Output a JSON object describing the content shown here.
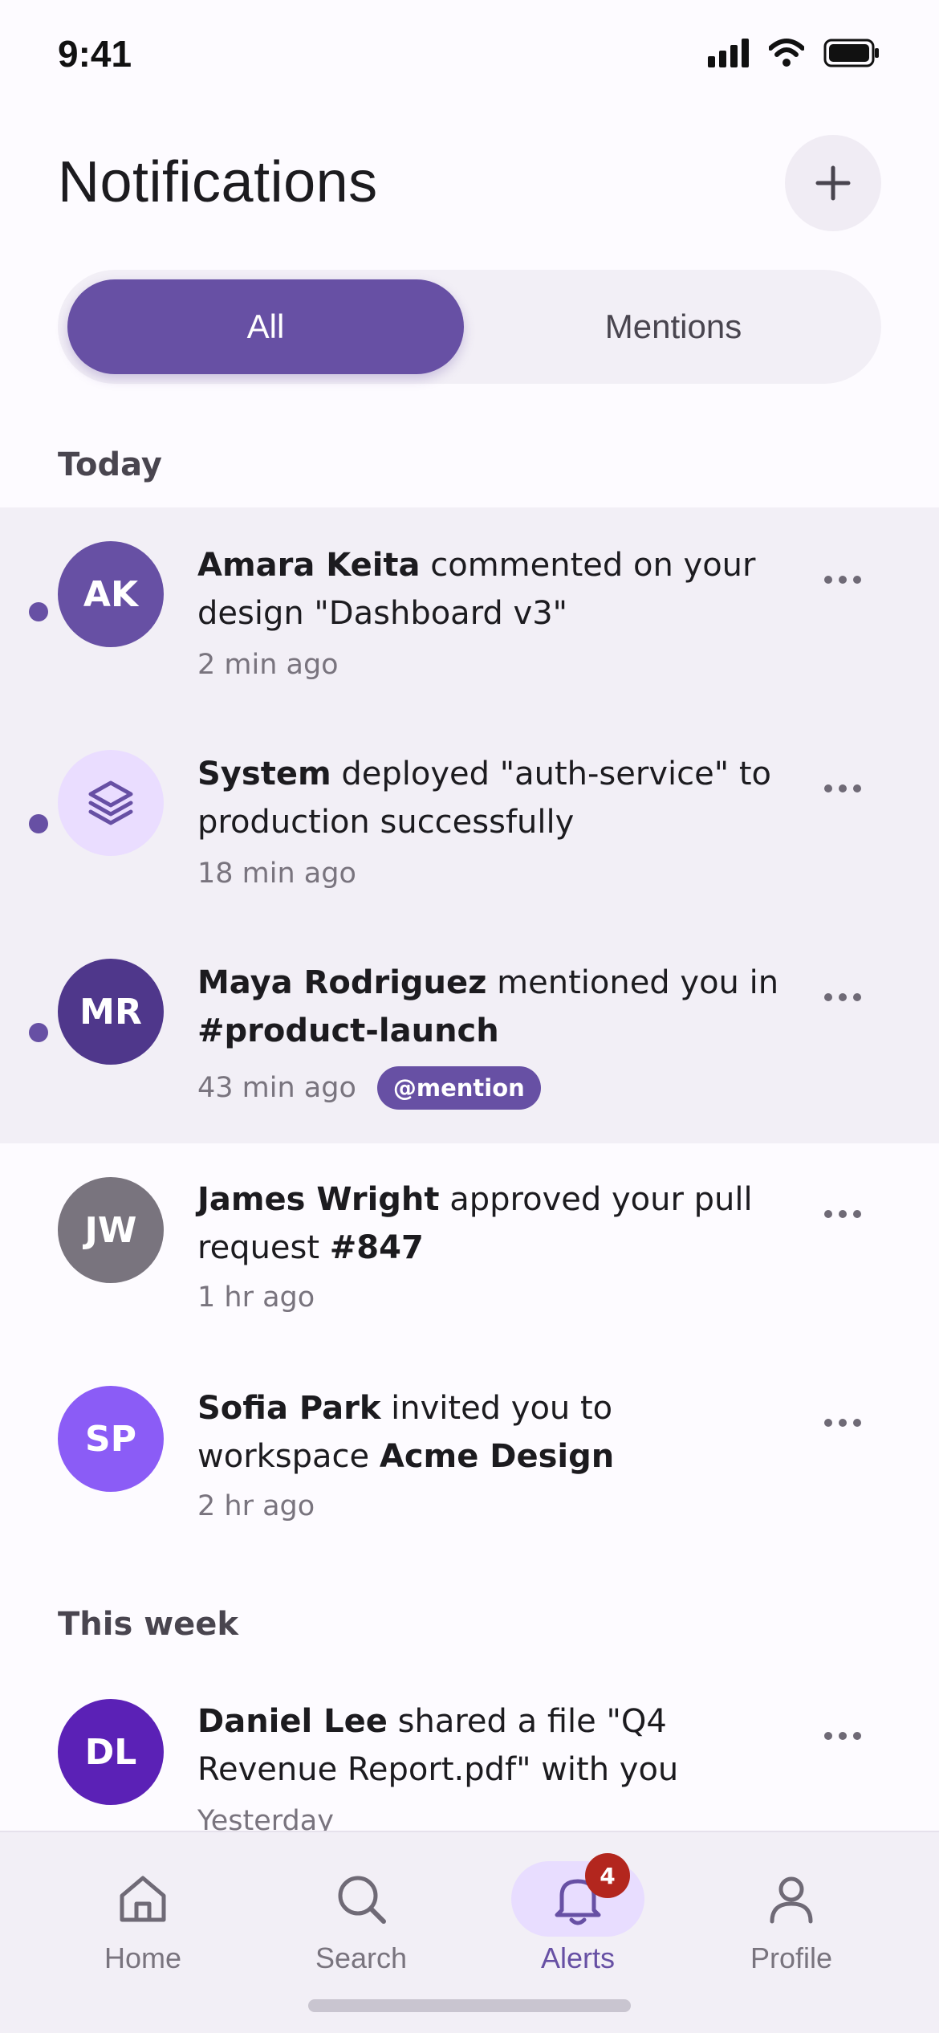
{
  "status_bar": {
    "time": "9:41"
  },
  "header": {
    "title": "Notifications",
    "add_icon": "plus-icon"
  },
  "tabs": [
    {
      "label": "All",
      "selected": true
    },
    {
      "label": "Mentions",
      "selected": false
    }
  ],
  "sections": {
    "today": "Today",
    "this_week": "This week"
  },
  "notifications": [
    {
      "initials": "AK",
      "actor": "Amara Keita",
      "text": " commented on your design \"Dashboard v3\"",
      "time": "2 min ago",
      "unread": true,
      "avatar_color": "#6750a4"
    },
    {
      "initials": "",
      "icon": "layers-icon",
      "actor": "System",
      "text": " deployed \"auth-service\" to production successfully",
      "time": "18 min ago",
      "unread": true,
      "avatar_color": "#eaddff"
    },
    {
      "initials": "MR",
      "actor": "Maya Rodriguez",
      "text": " mentioned you in ",
      "target": "#product-launch",
      "time": "43 min ago",
      "badge": "@mention",
      "unread": true,
      "avatar_color": "#4f378b"
    },
    {
      "initials": "JW",
      "actor": "James Wright",
      "text": " approved your pull request ",
      "target": "#847",
      "time": "1 hr ago",
      "unread": false,
      "avatar_color": "#79747e"
    },
    {
      "initials": "SP",
      "actor": "Sofia Park",
      "text": " invited you to workspace ",
      "target": "Acme Design",
      "time": "2 hr ago",
      "unread": false,
      "avatar_color": "#8b5cf6"
    },
    {
      "initials": "DL",
      "actor": "Daniel Lee",
      "text": " shared a file \"Q4 Revenue Report.pdf\" with you",
      "time": "Yesterday",
      "unread": false,
      "avatar_color": "#5b21b6"
    }
  ],
  "bottom_nav": [
    {
      "label": "Home",
      "icon": "home-icon",
      "active": false
    },
    {
      "label": "Search",
      "icon": "search-icon",
      "active": false
    },
    {
      "label": "Alerts",
      "icon": "bell-icon",
      "active": true,
      "badge": "4"
    },
    {
      "label": "Profile",
      "icon": "person-icon",
      "active": false
    }
  ],
  "colors": {
    "accent": "#6750a4",
    "unread_bg": "#f2eff6",
    "badge_red": "#b3261e"
  }
}
